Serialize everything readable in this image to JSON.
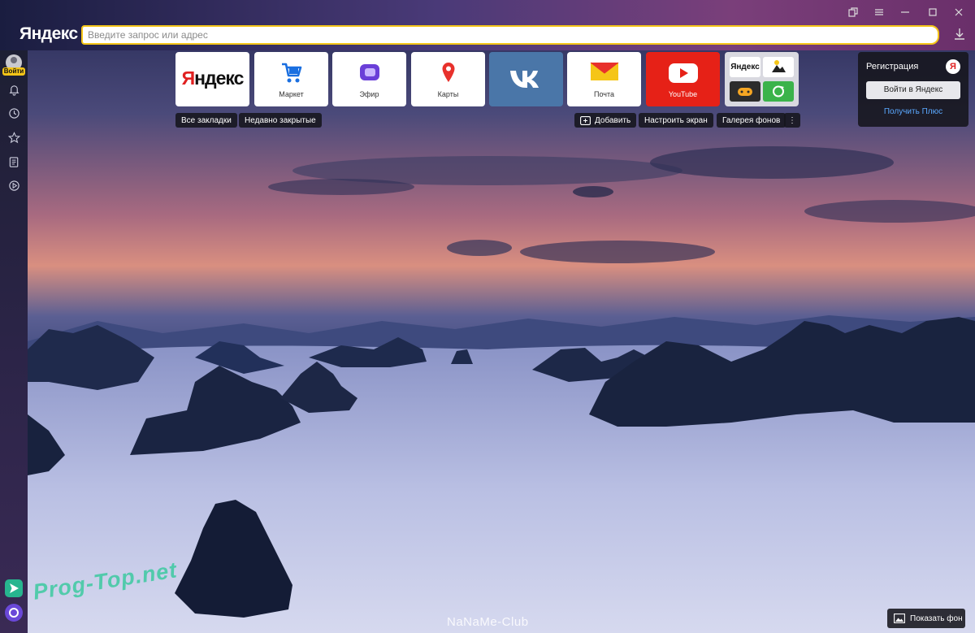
{
  "browser": {
    "logo": "Яндекс",
    "search_placeholder": "Введите запрос или адрес"
  },
  "sidebar": {
    "login_label": "Войти",
    "icons": [
      "bell-icon",
      "history-icon",
      "star-icon",
      "news-icon",
      "play-icon"
    ]
  },
  "tiles": [
    {
      "id": "yandex",
      "brand_first": "Я",
      "brand_rest": "ндекс",
      "label": ""
    },
    {
      "id": "market",
      "label": "Маркет"
    },
    {
      "id": "efir",
      "label": "Эфир"
    },
    {
      "id": "maps",
      "label": "Карты"
    },
    {
      "id": "vk",
      "label": ""
    },
    {
      "id": "mail",
      "label": "Почта"
    },
    {
      "id": "youtube",
      "label": "YouTube"
    },
    {
      "id": "group",
      "label": "",
      "mini_label": "Яндекс"
    }
  ],
  "actions": {
    "all_bookmarks": "Все закладки",
    "recently_closed": "Недавно закрытые",
    "add": "Добавить",
    "customize": "Настроить экран",
    "gallery": "Галерея фонов",
    "more": "⋮"
  },
  "account": {
    "title": "Регистрация",
    "badge": "Я",
    "login_button": "Войти в Яндекс",
    "plus_link": "Получить Плюс"
  },
  "show_background": "Показать фон",
  "watermarks": {
    "left": "Prog-Top.net",
    "center": "NaNaMe-Club"
  },
  "colors": {
    "accent": "#f5c518",
    "yandex_red": "#e02020",
    "youtube_red": "#e62117",
    "vk_blue": "#4a76a8",
    "link_blue": "#5aa8ff"
  }
}
